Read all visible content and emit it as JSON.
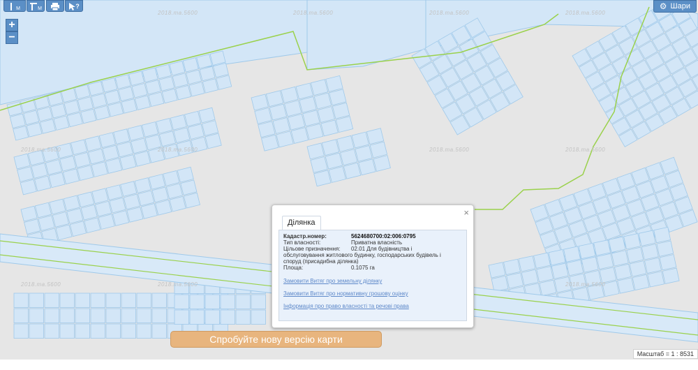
{
  "toolbar": {
    "measure_length": "М",
    "measure_area": "М",
    "print": "print",
    "identify": "?"
  },
  "zoom": {
    "in": "+",
    "out": "−"
  },
  "layers_label": "Шари",
  "watermark_text": "2018.ma.5600",
  "popup": {
    "close": "×",
    "tab": "Ділянка",
    "fields": [
      {
        "label": "Кадастр.номер:",
        "value": "5624680700:02:006:0795"
      },
      {
        "label": "Тип власності:",
        "value": "Приватна власність"
      },
      {
        "label": "Цільове призначення:",
        "value": "02.01 Для будівництва і"
      },
      {
        "label": "",
        "value": "обслуговування житлового будинку, господарських будівель і"
      },
      {
        "label": "",
        "value": "споруд (присадибна ділянка)"
      },
      {
        "label": "Площа:",
        "value": "0.1075 га"
      }
    ],
    "links": [
      "Замовити Витяг про земельну ділянку",
      "Замовити Витяг про нормативну грошову оцінку",
      "Інформація про право власності та речові права"
    ]
  },
  "try_button": "Спробуйте нову версію карти",
  "scale": "Масштаб = 1 : 8531",
  "colors": {
    "map_bg": "#e6e6e6",
    "parcel_fill": "#d3e6f7",
    "parcel_stroke": "#9fc9ea",
    "boundary": "#9ad14b",
    "accent": "#5b8fc6",
    "button": "#e8b57e"
  }
}
